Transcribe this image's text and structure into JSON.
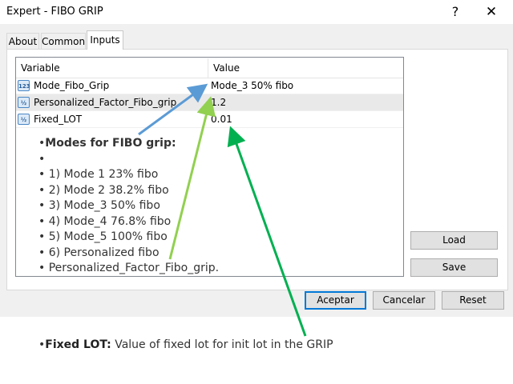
{
  "window": {
    "title": "Expert - FIBO GRIP",
    "help_glyph": "?",
    "close_glyph": "✕"
  },
  "tabs": [
    {
      "label": "About"
    },
    {
      "label": "Common"
    },
    {
      "label": "Inputs"
    }
  ],
  "table": {
    "columns": [
      "Variable",
      "Value"
    ],
    "rows": [
      {
        "icon": "123",
        "icon_name": "numeric-type-icon",
        "variable": "Mode_Fibo_Grip",
        "value": "Mode_3 50% fibo"
      },
      {
        "icon": "½",
        "icon_name": "double-type-icon",
        "variable": "Personalized_Factor_Fibo_grip",
        "value": "1.2"
      },
      {
        "icon": "½",
        "icon_name": "double-type-icon",
        "variable": "Fixed_LOT",
        "value": "0.01"
      }
    ]
  },
  "buttons": {
    "load": "Load",
    "save": "Save",
    "aceptar": "Aceptar",
    "cancelar": "Cancelar",
    "reset": "Reset"
  },
  "notes": {
    "title_bullet": "•",
    "title": "Modes for FIBO grip:",
    "bullet": "•",
    "items": [
      "",
      "1) Mode 1 23% fibo",
      "2) Mode 2 38.2% fibo",
      "3) Mode_3 50% fibo",
      "4) Mode_4 76.8% fibo",
      "5) Mode_5 100% fibo",
      "6) Personalized fibo",
      "Personalized_Factor_Fibo_grip."
    ]
  },
  "lot_note": {
    "bullet": "•",
    "label": "Fixed LOT:",
    "text": " Value of fixed lot  for init lot in the GRIP"
  },
  "colors": {
    "arrow_blue": "#5b9bd5",
    "arrow_lightgreen": "#92d050",
    "arrow_green": "#00b050",
    "focus_border": "#0078d7"
  }
}
